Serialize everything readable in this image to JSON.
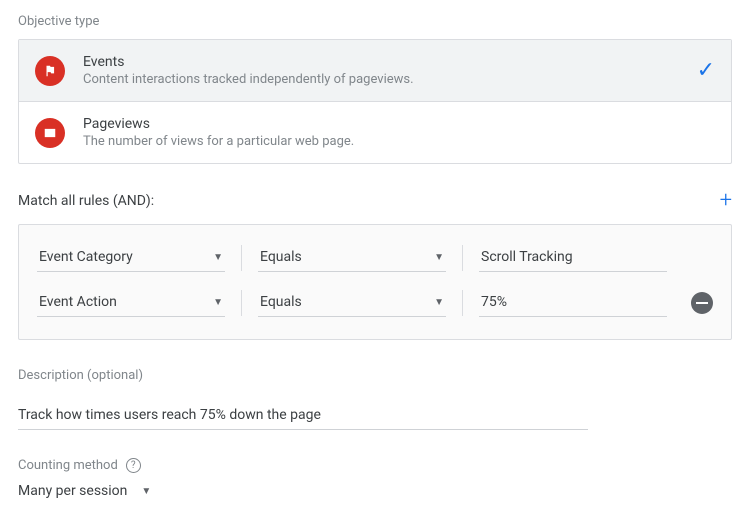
{
  "objective": {
    "label": "Objective type",
    "options": [
      {
        "title": "Events",
        "subtitle": "Content interactions tracked independently of pageviews.",
        "selected": true
      },
      {
        "title": "Pageviews",
        "subtitle": "The number of views for a particular web page.",
        "selected": false
      }
    ]
  },
  "rules": {
    "title": "Match all rules (AND):",
    "rows": [
      {
        "dimension": "Event Category",
        "operator": "Equals",
        "value": "Scroll Tracking",
        "removable": false
      },
      {
        "dimension": "Event Action",
        "operator": "Equals",
        "value": "75%",
        "removable": true
      }
    ]
  },
  "description": {
    "label": "Description (optional)",
    "value": "Track how times users reach 75% down the page"
  },
  "counting": {
    "label": "Counting method",
    "value": "Many per session"
  }
}
